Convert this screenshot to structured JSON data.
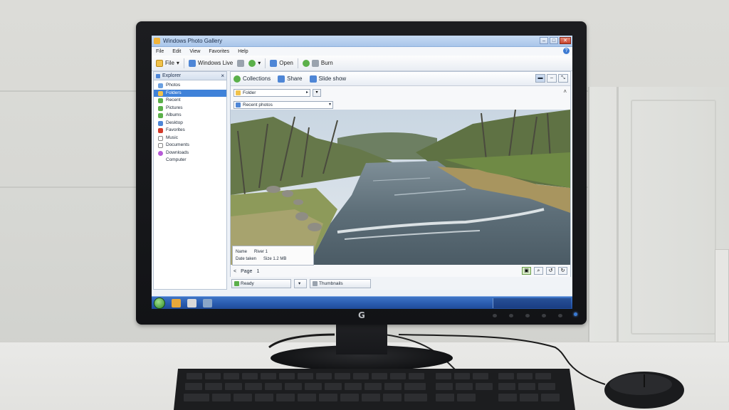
{
  "window": {
    "title": "Windows Photo Gallery"
  },
  "menu": {
    "items": [
      "File",
      "Edit",
      "View",
      "Favorites",
      "Help"
    ]
  },
  "toolbar": {
    "file_label": "File",
    "second_label": "Windows Live",
    "third_label": "Open",
    "fourth_label": "Burn"
  },
  "sidebar": {
    "header": "Explorer",
    "items": [
      "Photos",
      "Folders",
      "Recent",
      "Pictures",
      "Albums",
      "Desktop",
      "Favorites",
      "Music",
      "Documents",
      "Downloads",
      "Computer"
    ],
    "selected_index": 1
  },
  "content": {
    "tabs": [
      "Collections",
      "Share",
      "Slide show"
    ],
    "path_value": "Folder",
    "filter_value": "Recent photos"
  },
  "info": {
    "row1_label": "Name",
    "row1_value": "River 1",
    "row2_label": "Date taken",
    "row2_value": "Size 1.2 MB"
  },
  "pager": {
    "prev": "<",
    "page": "Page",
    "number": "1"
  },
  "status": {
    "field1": "Ready",
    "field2_arrow": "▾",
    "field3": "Thumbnails"
  },
  "colors": {
    "selection": "#3f82d9",
    "taskbar": "#2a5caf",
    "accent_green": "#5bb04a"
  },
  "monitor": {
    "brand_mark": "G"
  }
}
